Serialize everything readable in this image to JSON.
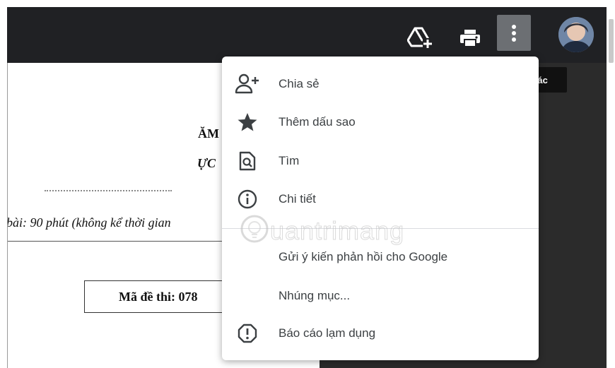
{
  "header": {
    "drive_icon": "add-to-drive-icon",
    "print_icon": "printer-icon",
    "more_icon": "more-vert-icon",
    "avatar": "user-avatar",
    "colors": {
      "bar": "#202124",
      "more_active": "#6c6f73"
    }
  },
  "tooltip": {
    "text": "Thao tác khác"
  },
  "menu": {
    "items": [
      {
        "label": "Chia sẻ",
        "icon": "person-add-icon"
      },
      {
        "label": "Thêm dấu sao",
        "icon": "star-icon"
      },
      {
        "label": "Tìm",
        "icon": "find-in-page-icon"
      },
      {
        "label": "Chi tiết",
        "icon": "info-icon"
      },
      {
        "label": "Gửi ý kiến phản hồi cho Google",
        "icon": ""
      },
      {
        "label": "Nhúng mục...",
        "icon": ""
      },
      {
        "label": "Báo cáo lạm dụng",
        "icon": "report-icon"
      }
    ]
  },
  "document": {
    "line1": "ĂM",
    "line2": "ỰC",
    "time_text": "bài: 90 phút (không kể thời gian",
    "exam_code": "Mã đề thi: 078"
  },
  "watermark": {
    "text": "uantrimang"
  }
}
